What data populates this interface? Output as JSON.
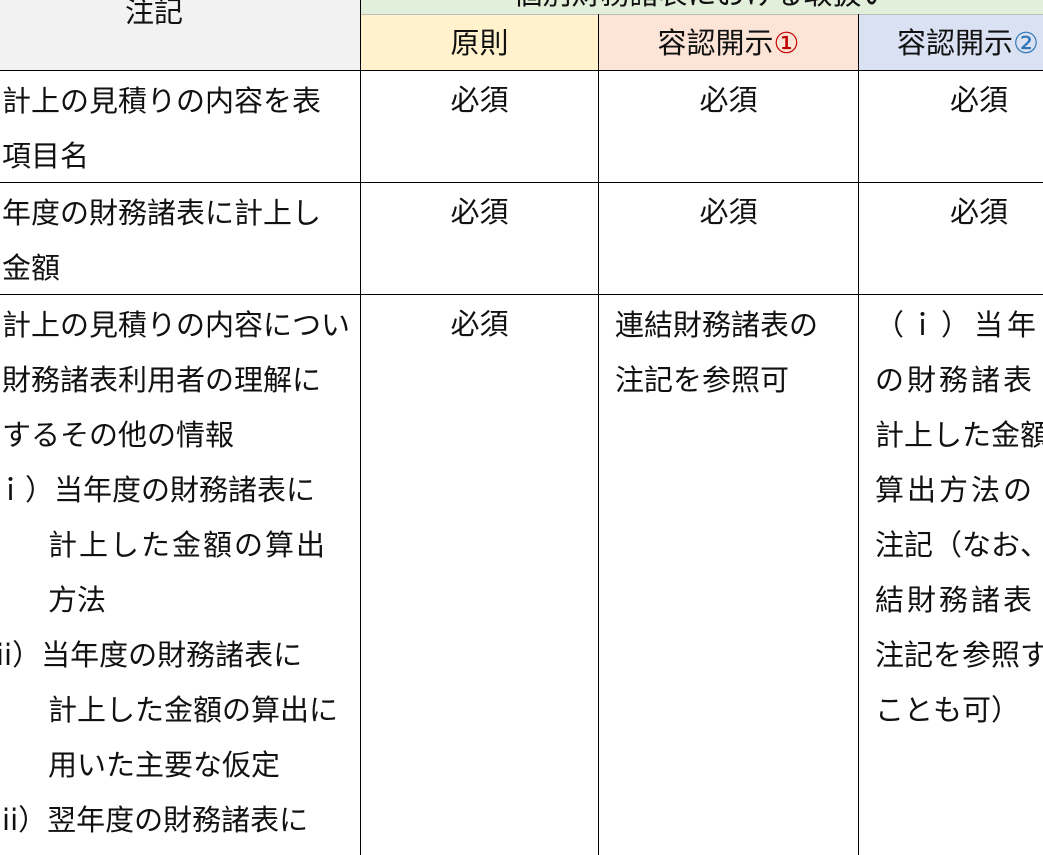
{
  "header": {
    "notes_label": "注記",
    "super_label": "個別財務諸表における取扱い",
    "columns": {
      "gensoku": "原則",
      "yonin1_text": "容認開示",
      "yonin1_mark": "①",
      "yonin2_text": "容認開示",
      "yonin2_mark": "②"
    }
  },
  "rows": [
    {
      "notes": [
        "計上の見積りの内容を表",
        "項目名"
      ],
      "gensoku": "必須",
      "yonin1": "必須",
      "yonin2": "必須"
    },
    {
      "notes": [
        "年度の財務諸表に計上し",
        "金額"
      ],
      "gensoku": "必須",
      "yonin1": "必須",
      "yonin2": "必須"
    },
    {
      "notes": [
        "計上の見積りの内容につい",
        "財務諸表利用者の理解に",
        "するその他の情報",
        "ｉ）当年度の財務諸表に",
        "計上した金額の算出",
        "方法",
        "ii）当年度の財務諸表に",
        "計上した金額の算出に",
        "用いた主要な仮定",
        "iii）翌年度の財務諸表に"
      ],
      "gensoku": "必須",
      "yonin1": [
        "連結財務諸表の",
        "注記を参照可"
      ],
      "yonin2": [
        "（ｉ）当年",
        "の財務諸表",
        "計上した金額",
        "算出方法の",
        "注記（なお、",
        "結財務諸表",
        "注記を参照す",
        "ことも可）"
      ]
    }
  ]
}
